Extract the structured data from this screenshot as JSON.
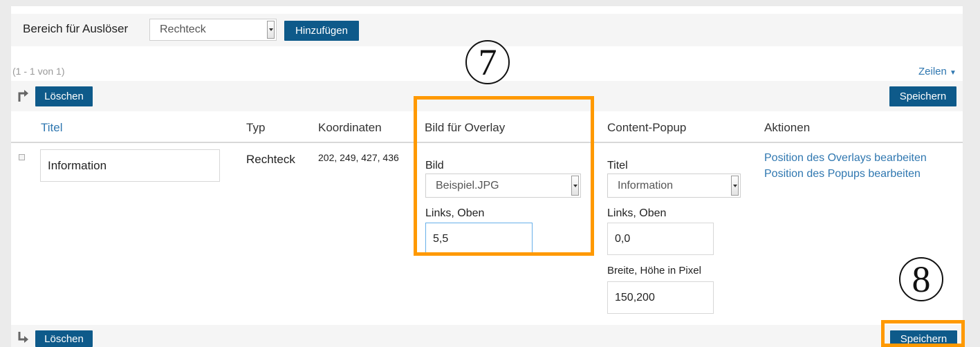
{
  "trigger_area": {
    "label": "Bereich für Auslöser",
    "select_value": "Rechteck",
    "add_label": "Hinzufügen"
  },
  "pagination": {
    "range": "(1 - 1 von 1)",
    "rows_label": "Zeilen"
  },
  "toolbar": {
    "delete_label": "Löschen",
    "save_label": "Speichern"
  },
  "table": {
    "headers": [
      "Titel",
      "Typ",
      "Koordinaten",
      "Bild für Overlay",
      "Content-Popup",
      "Aktionen"
    ],
    "row": {
      "title_value": "Information",
      "type": "Rechteck",
      "coordinates": "202, 249, 427, 436",
      "overlay": {
        "image_label": "Bild",
        "image_value": "Beispiel.JPG",
        "position_label": "Links, Oben",
        "position_value": "5,5"
      },
      "popup": {
        "title_label": "Titel",
        "title_value": "Information",
        "position_label": "Links, Oben",
        "position_value": "0,0",
        "size_label": "Breite, Höhe in Pixel",
        "size_value": "150,200"
      },
      "actions": [
        "Position des Overlays bearbeiten",
        "Position des Popups bearbeiten"
      ]
    }
  },
  "annotations": {
    "step7": "7",
    "step8": "8"
  },
  "colors": {
    "button": "#0e5a8a",
    "link": "#2f77b0",
    "highlight": "#ff9900"
  }
}
